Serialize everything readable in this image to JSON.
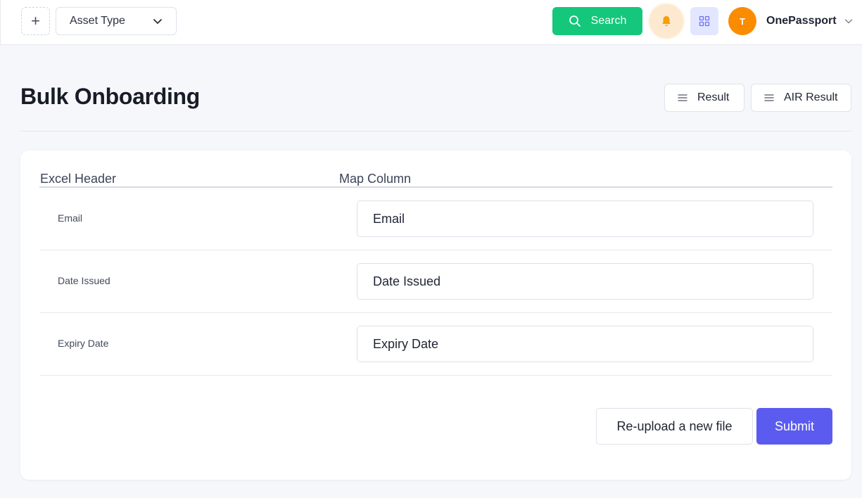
{
  "topbar": {
    "add_symbol": "+",
    "asset_select_value": "Asset Type",
    "search_label": "Search",
    "avatar_initial": "T",
    "user_name": "OnePassport"
  },
  "page": {
    "title": "Bulk Onboarding",
    "result_label": "Result",
    "air_result_label": "AIR Result"
  },
  "mapping": {
    "headers": {
      "excel_header": "Excel Header",
      "map_column": "Map Column"
    },
    "rows": [
      {
        "label": "Email",
        "value": "Email"
      },
      {
        "label": "Date Issued",
        "value": "Date Issued"
      },
      {
        "label": "Expiry Date",
        "value": "Expiry Date"
      }
    ]
  },
  "actions": {
    "reupload_label": "Re-upload a new file",
    "submit_label": "Submit"
  },
  "colors": {
    "search": "#14c77b",
    "submit": "#5b5bf0",
    "avatar": "#fb8c00",
    "bell": "#f59e0b"
  },
  "icons": [
    "plus-icon",
    "chevron-down-icon",
    "search-icon",
    "bell-icon",
    "grid-icon",
    "menu-lines-icon"
  ]
}
